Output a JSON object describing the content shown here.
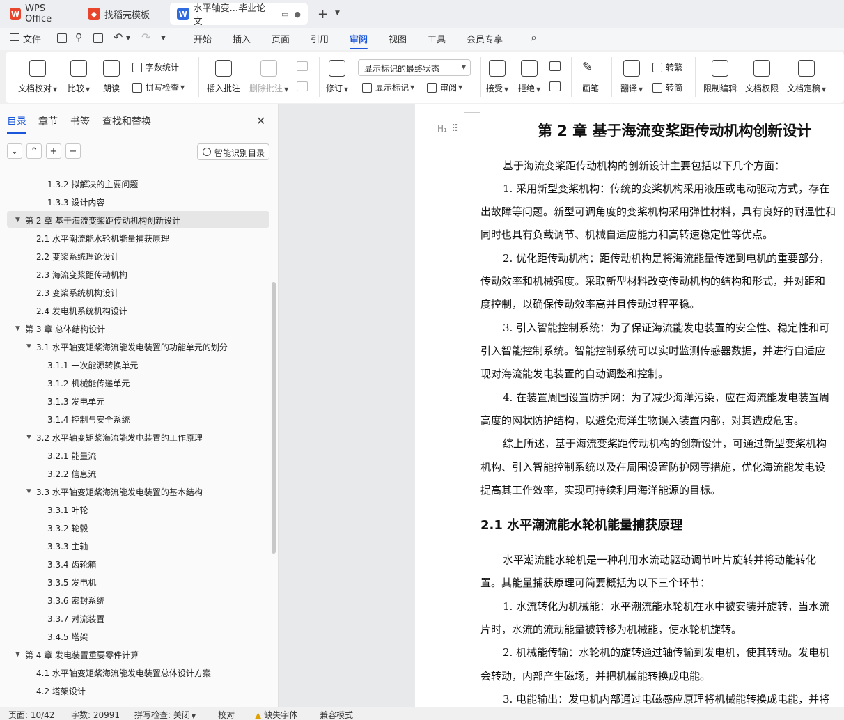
{
  "tabs": [
    {
      "label": "WPS Office"
    },
    {
      "label": "找稻壳模板"
    },
    {
      "label": "水平轴变...毕业论文"
    }
  ],
  "menubar": {
    "file": "文件",
    "items": [
      "开始",
      "插入",
      "页面",
      "引用",
      "审阅",
      "视图",
      "工具",
      "会员专享"
    ],
    "active": "审阅"
  },
  "ribbon": {
    "doc_check": "文档校对",
    "compare": "比较",
    "read_aloud": "朗读",
    "word_count": "字数统计",
    "spell_check": "拼写检查",
    "insert_comment": "插入批注",
    "delete_comment": "删除批注",
    "revise": "修订",
    "markup_state": "显示标记的最终状态",
    "show_markup": "显示标记",
    "review": "审阅",
    "accept": "接受",
    "reject": "拒绝",
    "pen": "画笔",
    "translate": "翻译",
    "to_traditional": "转繁",
    "to_simplified": "转简",
    "restrict_edit": "限制编辑",
    "doc_permission": "文档权限",
    "doc_finalize": "文档定稿"
  },
  "panel": {
    "tabs": [
      "目录",
      "章节",
      "书签",
      "查找和替换"
    ],
    "smart_toc": "智能识别目录",
    "toc": [
      {
        "text": "1.3.2 拟解决的主要问题"
      },
      {
        "text": "1.3.3 设计内容"
      },
      {
        "text": "第 2 章  基于海流变桨距传动机构创新设计"
      },
      {
        "text": "2.1  水平潮流能水轮机能量捕获原理"
      },
      {
        "text": "2.2  变桨系统理论设计"
      },
      {
        "text": "2.3  海流变桨距传动机构"
      },
      {
        "text": "2.3  变桨系统机构设计"
      },
      {
        "text": "2.4  发电机系统机构设计"
      },
      {
        "text": "第 3 章  总体结构设计"
      },
      {
        "text": "3.1 水平轴变矩桨海流能发电装置的功能单元的划分"
      },
      {
        "text": "3.1.1 一次能源转换单元"
      },
      {
        "text": "3.1.2 机械能传递单元"
      },
      {
        "text": "3.1.3 发电单元"
      },
      {
        "text": "3.1.4 控制与安全系统"
      },
      {
        "text": "3.2 水平轴变矩桨海流能发电装置的工作原理"
      },
      {
        "text": "3.2.1 能量流"
      },
      {
        "text": "3.2.2 信息流"
      },
      {
        "text": "3.3 水平轴变矩桨海流能发电装置的基本结构"
      },
      {
        "text": "3.3.1  叶轮"
      },
      {
        "text": "3.3.2  轮毂"
      },
      {
        "text": "3.3.3  主轴"
      },
      {
        "text": "3.3.4  齿轮箱"
      },
      {
        "text": "3.3.5  发电机"
      },
      {
        "text": "3.3.6  密封系统"
      },
      {
        "text": "3.3.7  对流装置"
      },
      {
        "text": "3.4.5  塔架"
      },
      {
        "text": "第 4 章  发电装置重要零件计算"
      },
      {
        "text": "4.1  水平轴变矩桨海流能发电装置总体设计方案"
      },
      {
        "text": "4.2 塔架设计"
      }
    ]
  },
  "doc": {
    "chapter_title": "第 2 章  基于海流变桨距传动机构创新设计",
    "heading_marker": "H₁",
    "section_title": "2.1  水平潮流能水轮机能量捕获原理",
    "paragraphs": [
      "基于海流变桨距传动机构的创新设计主要包括以下几个方面：",
      "1.  采用新型变桨机构：传统的变桨机构采用液压或电动驱动方式，存在",
      "出故障等问题。新型可调角度的变桨机构采用弹性材料，具有良好的耐温性和",
      "同时也具有负载调节、机械自适应能力和高转速稳定性等优点。",
      "2.  优化距传动机构：距传动机构是将海流能量传递到电机的重要部分，",
      "传动效率和机械强度。采取新型材料改变传动机构的结构和形式，并对距和",
      "度控制，以确保传动效率高并且传动过程平稳。",
      "3.  引入智能控制系统：为了保证海流能发电装置的安全性、稳定性和可",
      "引入智能控制系统。智能控制系统可以实时监测传感器数据，并进行自适应",
      "现对海流能发电装置的自动调整和控制。",
      "4.  在装置周围设置防护网：为了减少海洋污染，应在海流能发电装置周",
      "高度的网状防护结构，以避免海洋生物误入装置内部，对其造成危害。",
      "综上所述，基于海流变桨距传动机构的创新设计，可通过新型变桨机构",
      "机构、引入智能控制系统以及在周围设置防护网等措施，优化海流能发电设",
      "提高其工作效率，实现可持续利用海洋能源的目标。"
    ],
    "paragraphs2": [
      "水平潮流能水轮机是一种利用水流动驱动调节叶片旋转并将动能转化",
      "置。其能量捕获原理可简要概括为以下三个环节：",
      "1.  水流转化为机械能：水平潮流能水轮机在水中被安装并旋转，当水流",
      "片时，水流的流动能量被转移为机械能，使水轮机旋转。",
      "2.  机械能传输：水轮机的旋转通过轴传输到发电机，使其转动。发电机",
      "会转动，内部产生磁场，并把机械能转换成电能。",
      "3.  电能输出：发电机内部通过电磁感应原理将机械能转换成电能，并将"
    ]
  },
  "status": {
    "page": "页面: 10/42",
    "words": "字数: 20991",
    "spell": "拼写检查: 关闭",
    "proof": "校对",
    "missing_font": "缺失字体",
    "compat": "兼容模式"
  },
  "colors": {
    "accent": "#1a56db",
    "wps_red": "#e8452c"
  }
}
